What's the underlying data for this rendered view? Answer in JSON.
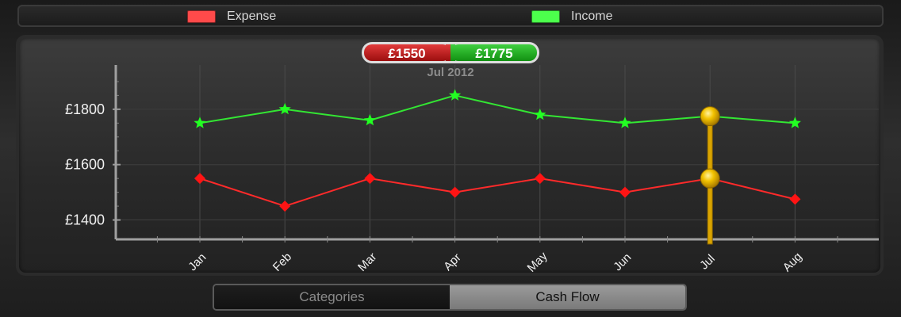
{
  "legend": {
    "items": [
      {
        "label": "Expense",
        "color": "#ff4a4a"
      },
      {
        "label": "Income",
        "color": "#4cff4c"
      }
    ]
  },
  "tooltip": {
    "expense_value": "£1550",
    "income_value": "£1775",
    "date_label": "Jul 2012"
  },
  "segmented_control": {
    "options": [
      "Categories",
      "Cash Flow"
    ],
    "selected": "Cash Flow"
  },
  "chart_data": {
    "type": "line",
    "categories": [
      "Jan",
      "Feb",
      "Mar",
      "Apr",
      "May",
      "Jun",
      "Jul",
      "Aug"
    ],
    "series": [
      {
        "name": "Expense",
        "color": "#ff2a2a",
        "values": [
          1550,
          1450,
          1550,
          1500,
          1550,
          1500,
          1550,
          1475
        ]
      },
      {
        "name": "Income",
        "color": "#33e633",
        "values": [
          1750,
          1800,
          1760,
          1850,
          1780,
          1750,
          1775,
          1750
        ]
      }
    ],
    "y_ticks": [
      "£1400",
      "£1600",
      "£1800"
    ],
    "y_tick_values": [
      1400,
      1600,
      1800
    ],
    "ylim": [
      1330,
      1960
    ],
    "selected_category": "Jul",
    "grid": true
  }
}
